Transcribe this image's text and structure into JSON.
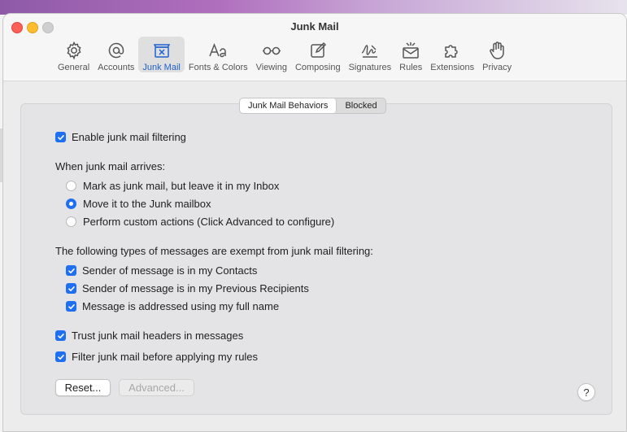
{
  "window": {
    "title": "Junk Mail"
  },
  "toolbar": {
    "items": [
      {
        "label": "General",
        "icon": "gear-icon"
      },
      {
        "label": "Accounts",
        "icon": "at-sign-icon"
      },
      {
        "label": "Junk Mail",
        "icon": "junk-tray-icon",
        "active": true
      },
      {
        "label": "Fonts & Colors",
        "icon": "font-aa-icon"
      },
      {
        "label": "Viewing",
        "icon": "glasses-icon"
      },
      {
        "label": "Composing",
        "icon": "compose-icon"
      },
      {
        "label": "Signatures",
        "icon": "signature-icon"
      },
      {
        "label": "Rules",
        "icon": "rules-icon"
      },
      {
        "label": "Extensions",
        "icon": "puzzle-icon"
      },
      {
        "label": "Privacy",
        "icon": "hand-icon"
      }
    ]
  },
  "tabs": {
    "behaviors": "Junk Mail Behaviors",
    "blocked": "Blocked",
    "selected": "Junk Mail Behaviors"
  },
  "settings": {
    "enable_filtering": {
      "label": "Enable junk mail filtering",
      "checked": true
    },
    "arrives_heading": "When junk mail arrives:",
    "arrives_options": [
      {
        "label": "Mark as junk mail, but leave it in my Inbox",
        "selected": false
      },
      {
        "label": "Move it to the Junk mailbox",
        "selected": true
      },
      {
        "label": "Perform custom actions (Click Advanced to configure)",
        "selected": false
      }
    ],
    "exempt_heading": "The following types of messages are exempt from junk mail filtering:",
    "exempt_options": [
      {
        "label": "Sender of message is in my Contacts",
        "checked": true
      },
      {
        "label": "Sender of message is in my Previous Recipients",
        "checked": true
      },
      {
        "label": "Message is addressed using my full name",
        "checked": true
      }
    ],
    "trust_headers": {
      "label": "Trust junk mail headers in messages",
      "checked": true
    },
    "filter_before_rules": {
      "label": "Filter junk mail before applying my rules",
      "checked": true
    }
  },
  "buttons": {
    "reset": "Reset...",
    "advanced": "Advanced...",
    "help": "?"
  },
  "colors": {
    "accent": "#1f6ff2",
    "active_label": "#2060d0"
  }
}
